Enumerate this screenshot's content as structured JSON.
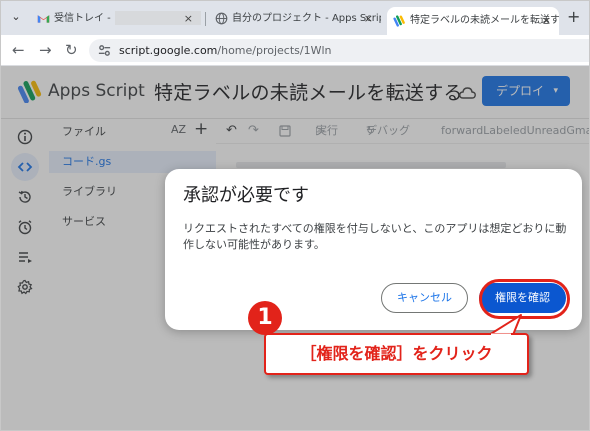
{
  "browser": {
    "tabs": [
      {
        "label": "受信トレイ -",
        "favicon": "gmail-icon",
        "close": "×"
      },
      {
        "label": "自分のプロジェクト - Apps Script",
        "favicon": "globe-icon",
        "close": "×"
      },
      {
        "label": "特定ラベルの未読メールを転送する",
        "favicon": "apps-script-icon",
        "close": "×"
      }
    ],
    "tab_dropdown": "⌄",
    "new_tab": "+",
    "nav": {
      "back": "←",
      "forward": "→",
      "reload": "↻"
    },
    "url_host": "script.google.com",
    "url_path": "/home/projects/1Wln"
  },
  "app": {
    "brand": "Apps Script",
    "project_title": "特定ラベルの未読メールを転送する",
    "deploy_label": "デプロイ",
    "deploy_caret": "▾"
  },
  "rail": {
    "icons": [
      "info-icon",
      "code-icon",
      "history-icon",
      "alarm-icon",
      "run-list-icon",
      "gear-icon"
    ]
  },
  "files": {
    "header": "ファイル",
    "sort_label": "AZ",
    "add_label": "+",
    "items": [
      {
        "label": "コード.gs"
      },
      {
        "label": "ライブラリ"
      },
      {
        "label": "サービス"
      }
    ]
  },
  "toolbar": {
    "undo": "↶",
    "redo": "↷",
    "run_label": "実行",
    "debug_label": "デバッグ",
    "function_name": "forwardLabeledUnreadGmails"
  },
  "dialog": {
    "title": "承認が必要です",
    "body": "リクエストされたすべての権限を付与しないと、このアプリは想定どおりに動作しない可能性があります。",
    "cancel_label": "キャンセル",
    "confirm_label": "権限を確認"
  },
  "annotation": {
    "step_number": "1",
    "callout_text": "［権限を確認］をクリック",
    "color": "#e2231a"
  },
  "colors": {
    "accent": "#1a73e8",
    "confirm_button": "#0b57d0"
  }
}
